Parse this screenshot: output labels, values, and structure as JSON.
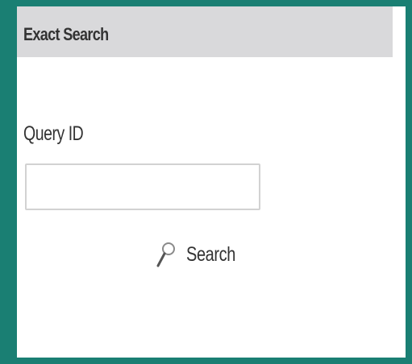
{
  "panel": {
    "title": "Exact Search"
  },
  "query_field": {
    "label": "Query ID",
    "value": "",
    "placeholder": ""
  },
  "search_button": {
    "label": "Search",
    "icon": "magnifier-icon"
  },
  "colors": {
    "frame_border": "#1a7f73",
    "header_background": "#d9d9db",
    "text": "#333333"
  }
}
